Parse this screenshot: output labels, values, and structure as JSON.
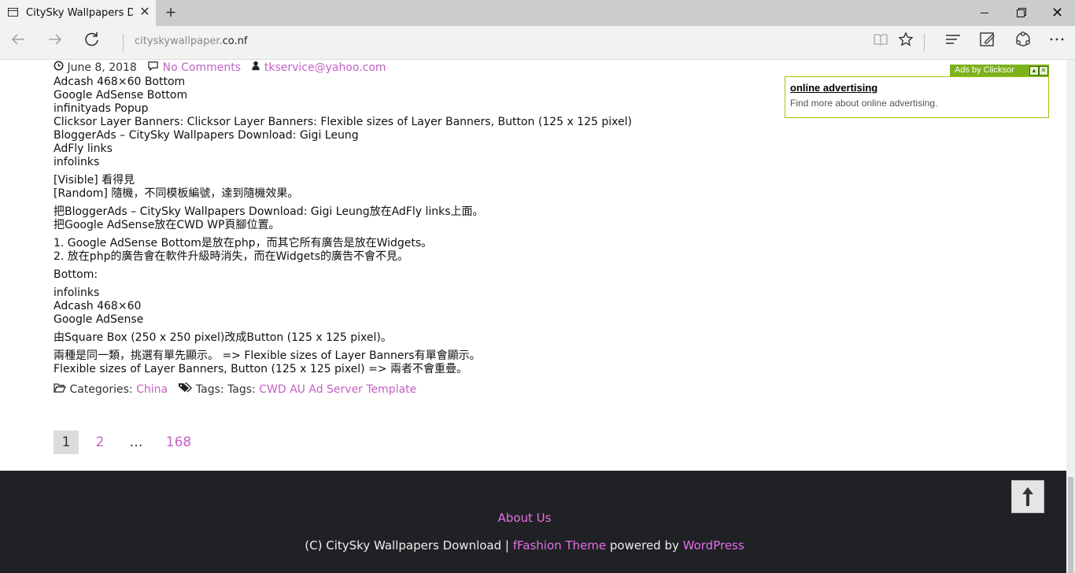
{
  "browser": {
    "tab_title": "CitySky Wallpapers Download",
    "tab_close": "✕",
    "new_tab": "+",
    "address_prefix": "cityskywallpaper.",
    "address_domain": "co.nf",
    "icons": [
      "back-icon",
      "forward-icon",
      "refresh-icon",
      "reading-view-icon",
      "favorite-star-icon",
      "hub-icon",
      "web-note-icon",
      "share-icon",
      "more-icon"
    ]
  },
  "article": {
    "date": "June 8, 2018",
    "comments": "No Comments",
    "author": "tkservice@yahoo.com",
    "list1": [
      "Adcash 468×60 Bottom",
      "Google AdSense Bottom",
      "infinityads Popup",
      "Clicksor Layer Banners: Clicksor Layer Banners: Flexible sizes of Layer Banners, Button (125 x 125 pixel)",
      "BloggerAds – CitySky Wallpapers Download: Gigi Leung",
      "AdFly links",
      "infolinks"
    ],
    "visible_line": "[Visible] 看得見",
    "random_line": "[Random] 隨機，不同模板編號，達到隨機效果。",
    "move_line1": "把BloggerAds – CitySky Wallpapers Download: Gigi Leung放在AdFly links上面。",
    "move_line2": "把Google AdSense放在CWD WP頁腳位置。",
    "note1": "1. Google AdSense Bottom是放在php，而其它所有廣告是放在Widgets。",
    "note2": "2. 放在php的廣告會在軟件升級時消失，而在Widgets的廣告不會不見。",
    "bottom_label": "Bottom:",
    "list2": [
      "infolinks",
      "Adcash 468×60",
      "Google AdSense"
    ],
    "square_line": "由Square Box (250 x 250 pixel)改成Button (125 x 125 pixel)。",
    "same_line1": "兩種是同一類，挑選有單先顯示。 => Flexible sizes of Layer Banners有單會顯示。",
    "same_line2": "Flexible sizes of Layer Banners, Button (125 x 125 pixel) => 兩者不會重疊。",
    "categories_label": "Categories:",
    "category": "China",
    "tags_label": "Tags: Tags:",
    "tag": "CWD AU Ad Server Template"
  },
  "pagination": {
    "current": "1",
    "next": "2",
    "ellipsis": "…",
    "last": "168"
  },
  "ad": {
    "tag_label": "Ads by Clicksor",
    "title": "online advertising",
    "description": "Find more about online advertising."
  },
  "footer": {
    "about": "About Us",
    "copy_prefix": "(C) CitySky Wallpapers Download | ",
    "theme": "fFashion Theme",
    "powered": " powered by ",
    "wordpress": "WordPress"
  },
  "back_to_top": "🠕"
}
